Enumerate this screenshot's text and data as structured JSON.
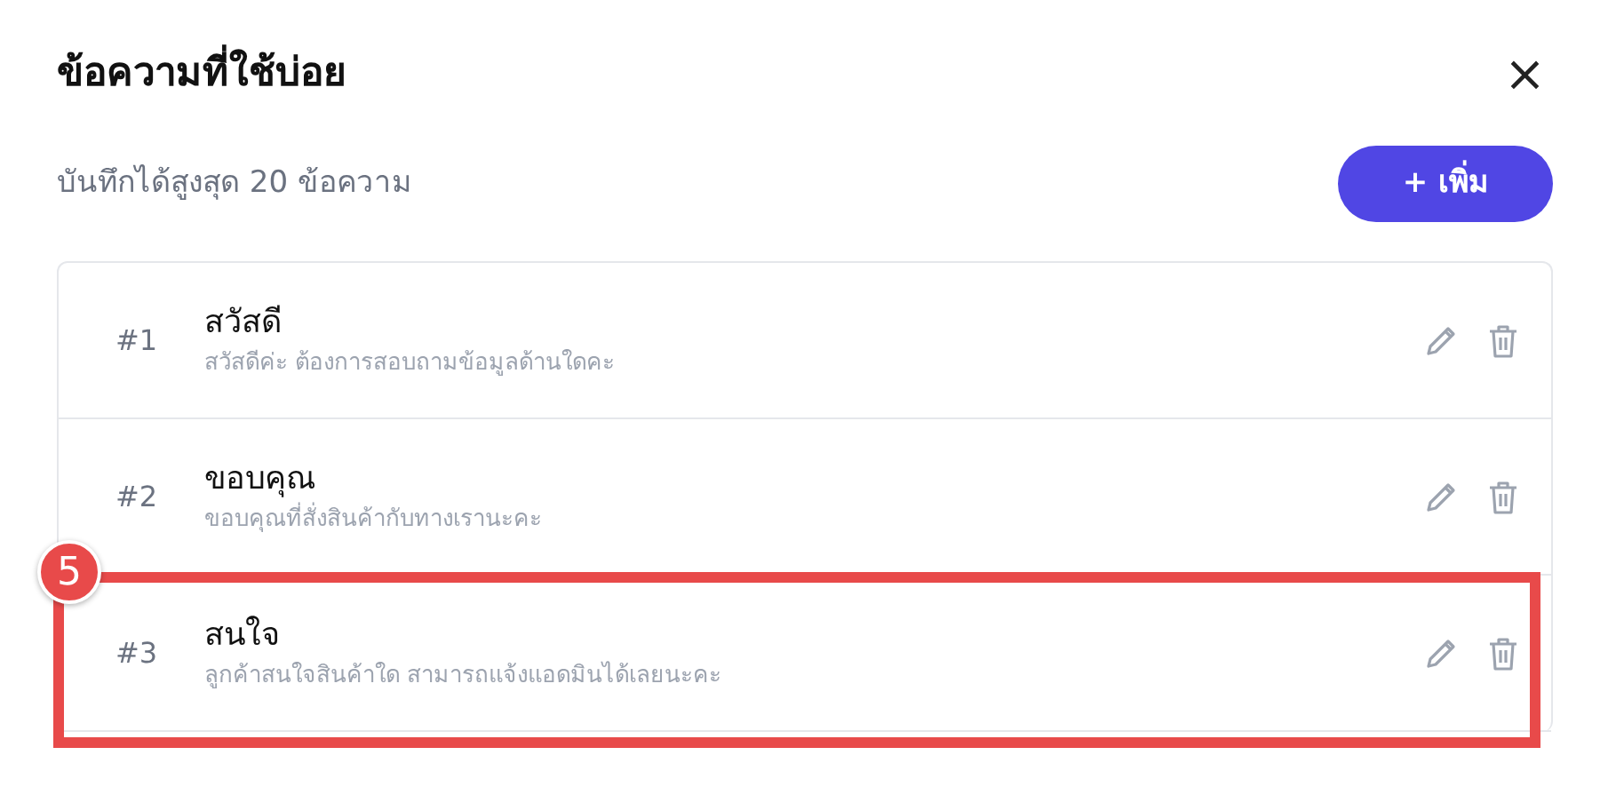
{
  "dialog": {
    "title": "ข้อความที่ใช้บ่อย",
    "close": "×",
    "subtitle": "บันทึกได้สูงสุด 20 ข้อความ",
    "add_button": {
      "icon": "+",
      "label": "เพิ่ม"
    }
  },
  "messages": [
    {
      "number": "#1",
      "title": "สวัสดี",
      "text": "สวัสดีค่ะ ต้องการสอบถามข้อมูลด้านใดคะ",
      "highlighted": false
    },
    {
      "number": "#2",
      "title": "ขอบคุณ",
      "text": "ขอบคุณที่สั่งสินค้ากับทางเรานะคะ",
      "highlighted": false
    },
    {
      "number": "#3",
      "title": "สนใจ",
      "text": "ลูกค้าสนใจสินค้าใด สามารถแจ้งแอดมินได้เลยนะคะ",
      "highlighted": true
    }
  ],
  "annotation": {
    "label": "5"
  }
}
